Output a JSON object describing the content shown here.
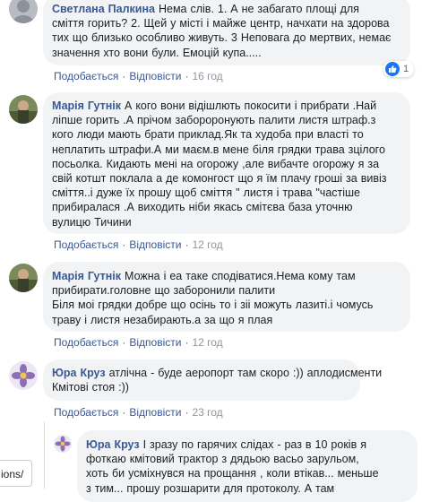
{
  "comments": [
    {
      "author": "Светлана Палкина",
      "lines": [
        "Нема слів. 1. А не забагато площі для",
        "сміття горить? 2. Щей у місті і майже центр, начхати на здорова",
        "тих що близько особливо живуть. 3 Неповага до мертвих, немає",
        "значення хто вони були. Емоцій купа....."
      ],
      "like_label": "Подобається",
      "reply_label": "Відповісти",
      "time": "16 год",
      "reaction_count": "1"
    },
    {
      "author": "Марія Гутнік",
      "lines": [
        "А кого вони відішлють покосити і прибрати .Най",
        "ліпше горить .А прічом забороронують палити листя штраф.з",
        "кого люди мають брати приклад.Як та худоба при власті то",
        "неплатить штрафи.А ми маєм.в мене біля грядки трава зцілого",
        "посьолка. Кидають мені на огорожу ,але вибачте огорожу я за",
        "свій котшт поклала а де комонгост що я їм плачу гроші за вивіз",
        "сміття..і дуже їх прошу щоб сміття \" листя і трава \"частіше",
        "прибиралася .А виходить ніби якась смітєва база уточню",
        "вулицю Тичини"
      ],
      "like_label": "Подобається",
      "reply_label": "Відповісти",
      "time": "12 год"
    },
    {
      "author": "Марія Гутнік",
      "lines": [
        "Можна і еа таке сподіватися.Нема кому там",
        "прибирати.головне що заборонили палити",
        "Біля моі грядки добре що осінь то і зіі можуть лазиті.і чомусь",
        "траву і листя незабирають.а за що я плая"
      ],
      "like_label": "Подобається",
      "reply_label": "Відповісти",
      "time": "12 год"
    },
    {
      "author": "Юра Круз",
      "lines": [
        "атлічна - буде аеропорт там скоро :)) аплодисменти",
        "Кмітові стоя :))"
      ],
      "like_label": "Подобається",
      "reply_label": "Відповісти",
      "time": "23 год"
    },
    {
      "author": "Юра Круз",
      "lines": [
        "І зразу по гарячих слідах - раз в 10 років я",
        "фоткаю кмітовий трактор з дядьою васьо зарульом,",
        "хоть би усміхнувся на прощання , коли втікав... меньше",
        "з тим... прошу розшарити для протоколу. А там"
      ]
    }
  ],
  "side_tab_label": "ions/",
  "colors": {
    "link": "#385898",
    "bubble": "#f2f3f5",
    "like_blue": "#1877f2"
  }
}
